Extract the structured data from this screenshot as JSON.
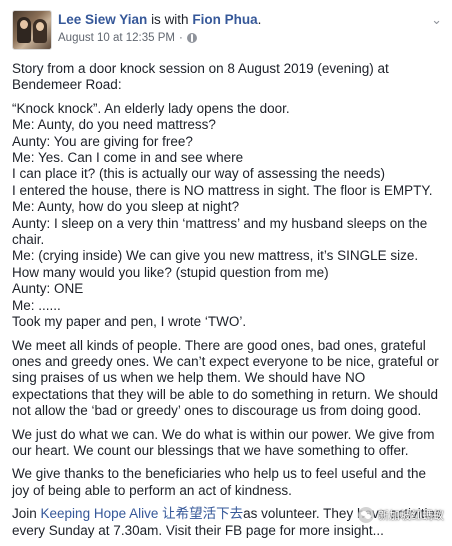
{
  "post": {
    "author": "Lee Siew Yian",
    "with_text": "is with",
    "tagged": "Fion Phua",
    "meta_separator": "·",
    "timestamp": "August 10 at 12:35 PM",
    "privacy_icon": "globe-icon",
    "options_icon": "chevron-down-icon",
    "paragraphs": [
      [
        "Story from a door knock session on 8 August 2019 (evening) at Bendemeer Road:"
      ],
      [
        "“Knock knock”. An elderly lady opens the door.",
        "Me: Aunty, do you need mattress?",
        "Aunty: You are giving for free?",
        "Me: Yes. Can I come in and see where",
        "I can place it? (this is actually our way of assessing the needs)",
        "I entered the house, there is NO mattress in sight. The floor is EMPTY.",
        "Me: Aunty, how do you sleep at night?",
        "Aunty: I sleep on a very thin ‘mattress’ and my husband sleeps on the chair.",
        "Me: (crying inside) We can give you new mattress, it’s SINGLE size. How many would you like? (stupid question from me)",
        "Aunty: ONE",
        "Me: ......",
        "Took my paper and pen, I wrote ‘TWO’."
      ],
      [
        "We meet all kinds of people. There are good ones, bad ones, grateful ones and greedy ones. We can’t expect everyone to be nice, grateful or sing praises of us when we help them. We should have NO expectations that they will be able to do something in return. We should not allow the ‘bad or greedy’ ones to discourage us from doing good."
      ],
      [
        "We just do what we can. We do what is within our power. We give from our heart. We count our blessings that we have something to offer."
      ],
      [
        "We give thanks to the beneficiaries who help us to feel useful and the joy of being able to perform an act of kindness."
      ]
    ],
    "closing": {
      "before": "Join ",
      "link": "Keeping Hope Alive 让希望活下去",
      "after": "as volunteer. They have activities every Sunday at 7.30am. Visit their FB page for more insight..."
    }
  },
  "watermark": {
    "text": "新加坡红螞蚁"
  },
  "colors": {
    "link": "#365899",
    "text": "#1d2129",
    "meta": "#616770"
  }
}
